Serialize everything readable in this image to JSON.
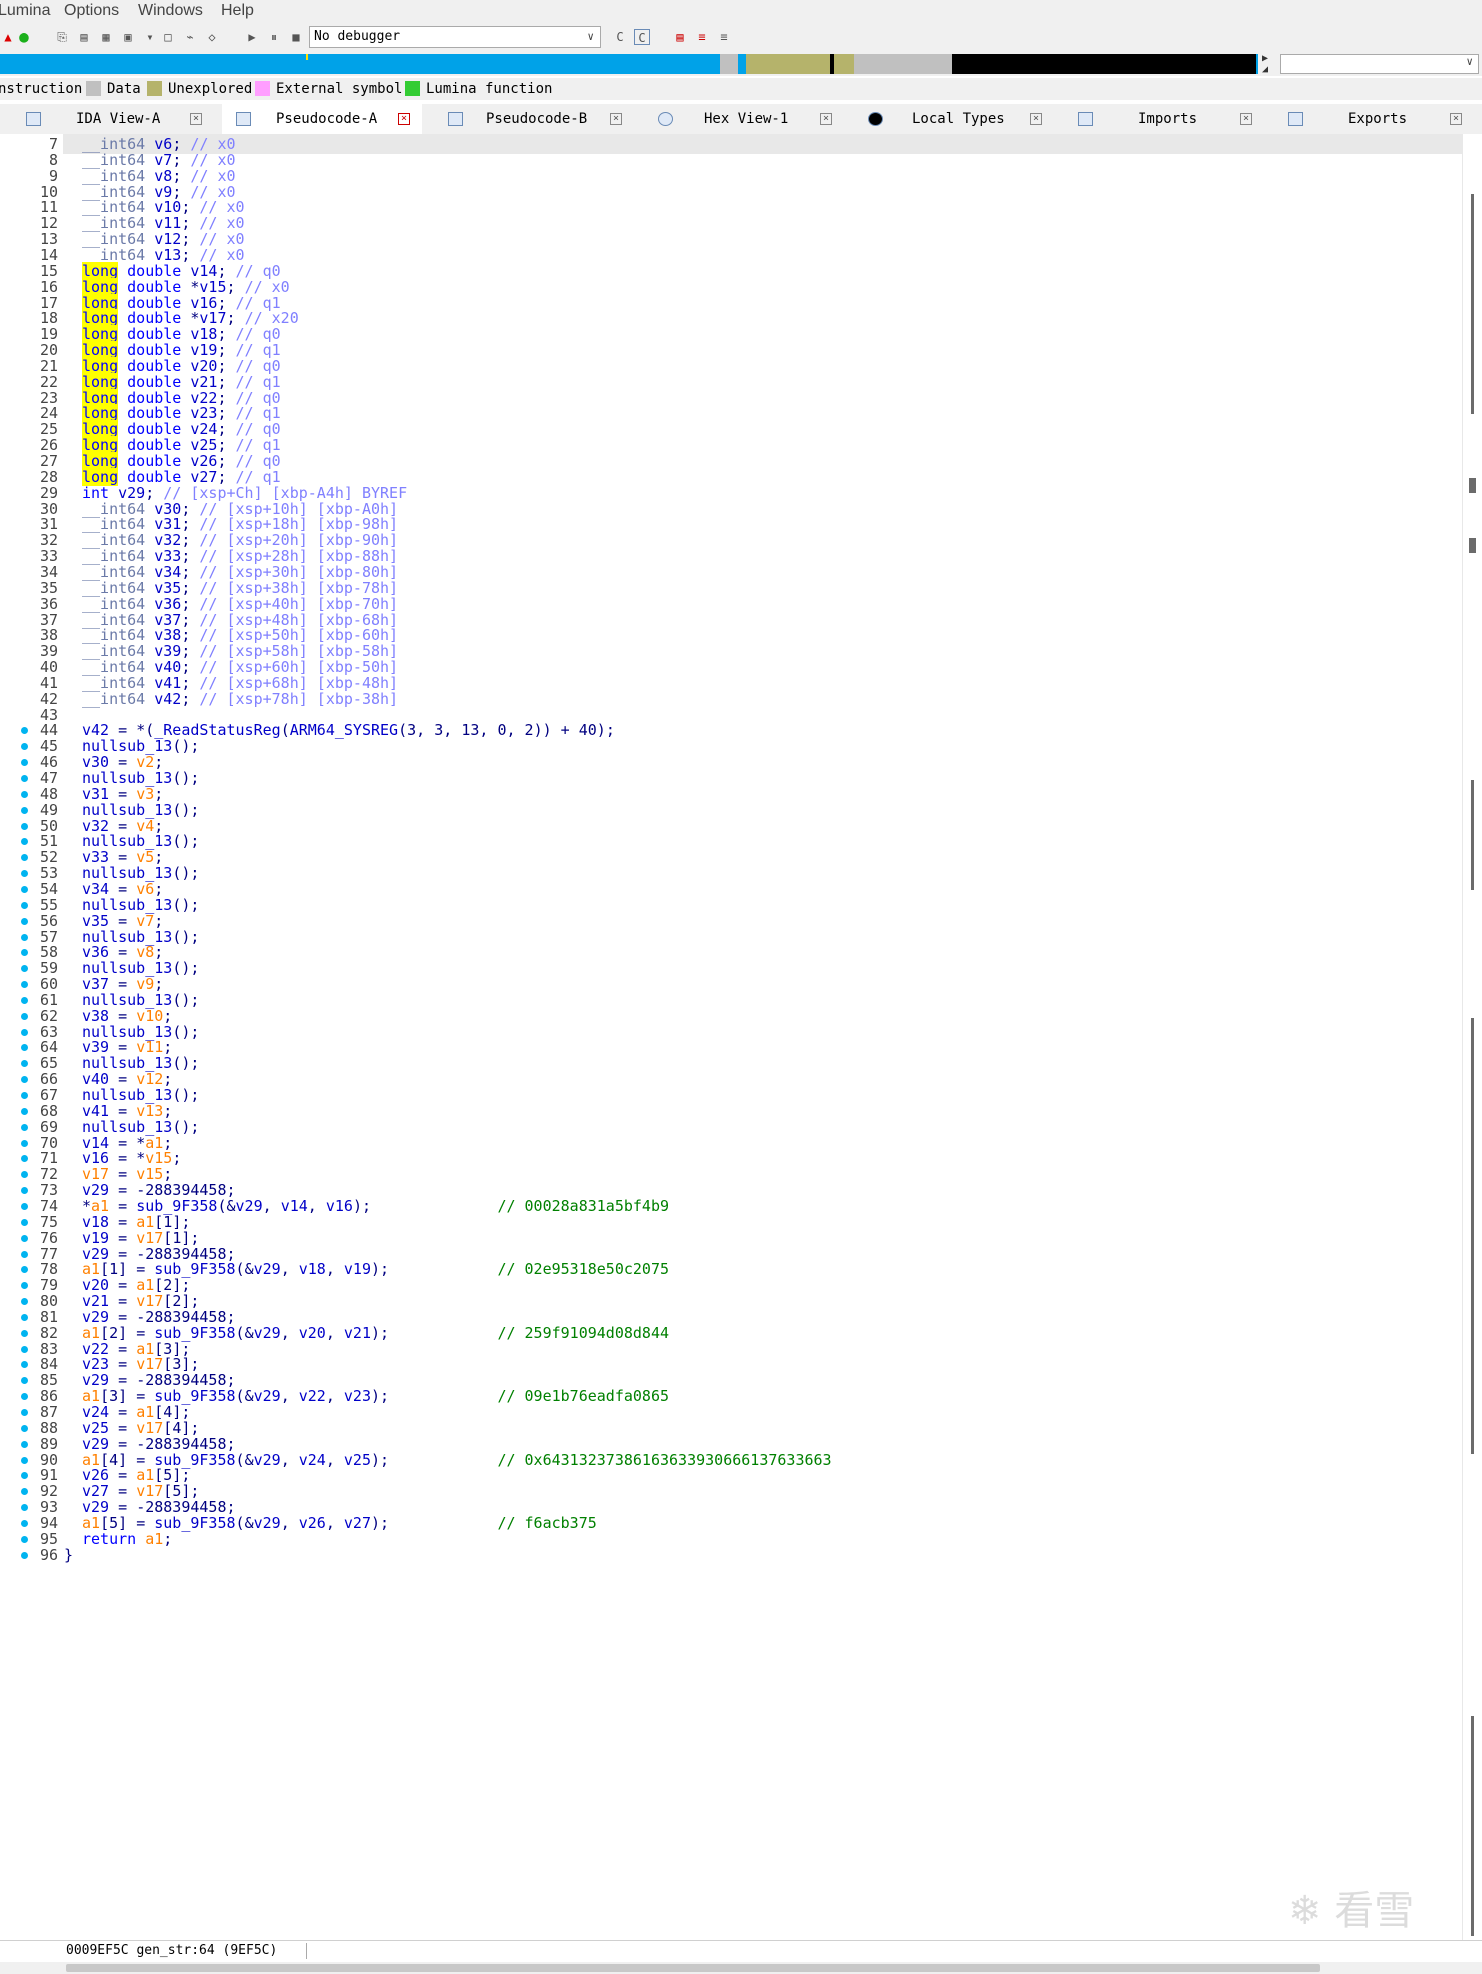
{
  "menu": {
    "items": [
      "Lumina",
      "Options",
      "Windows",
      "Help"
    ]
  },
  "toolbar": {
    "debugger": "No debugger"
  },
  "legend": {
    "items": [
      {
        "label": "nstruction",
        "color": ""
      },
      {
        "label": "Data",
        "color": "#c0c0c0"
      },
      {
        "label": "Unexplored",
        "color": "#b5b36b"
      },
      {
        "label": "External symbol",
        "color": "#ff9eff"
      },
      {
        "label": "Lumina function",
        "color": "#33cc33"
      }
    ]
  },
  "tabs": [
    {
      "label": "IDA View-A",
      "active": false
    },
    {
      "label": "Pseudocode-A",
      "active": true
    },
    {
      "label": "Pseudocode-B",
      "active": false
    },
    {
      "label": "Hex View-1",
      "active": false
    },
    {
      "label": "Local Types",
      "active": false
    },
    {
      "label": "Imports",
      "active": false
    },
    {
      "label": "Exports",
      "active": false
    }
  ],
  "code": {
    "lines": [
      {
        "n": "7",
        "dot": false,
        "t": "__int64 v6; // x0"
      },
      {
        "n": "8",
        "dot": false,
        "t": "__int64 v7; // x0"
      },
      {
        "n": "9",
        "dot": false,
        "t": "__int64 v8; // x0"
      },
      {
        "n": "10",
        "dot": false,
        "t": "__int64 v9; // x0"
      },
      {
        "n": "11",
        "dot": false,
        "t": "__int64 v10; // x0"
      },
      {
        "n": "12",
        "dot": false,
        "t": "__int64 v11; // x0"
      },
      {
        "n": "13",
        "dot": false,
        "t": "__int64 v12; // x0"
      },
      {
        "n": "14",
        "dot": false,
        "t": "__int64 v13; // x0"
      },
      {
        "n": "15",
        "dot": false,
        "t": "long double v14; // q0"
      },
      {
        "n": "16",
        "dot": false,
        "t": "long double *v15; // x0"
      },
      {
        "n": "17",
        "dot": false,
        "t": "long double v16; // q1"
      },
      {
        "n": "18",
        "dot": false,
        "t": "long double *v17; // x20"
      },
      {
        "n": "19",
        "dot": false,
        "t": "long double v18; // q0"
      },
      {
        "n": "20",
        "dot": false,
        "t": "long double v19; // q1"
      },
      {
        "n": "21",
        "dot": false,
        "t": "long double v20; // q0"
      },
      {
        "n": "22",
        "dot": false,
        "t": "long double v21; // q1"
      },
      {
        "n": "23",
        "dot": false,
        "t": "long double v22; // q0"
      },
      {
        "n": "24",
        "dot": false,
        "t": "long double v23; // q1"
      },
      {
        "n": "25",
        "dot": false,
        "t": "long double v24; // q0"
      },
      {
        "n": "26",
        "dot": false,
        "t": "long double v25; // q1"
      },
      {
        "n": "27",
        "dot": false,
        "t": "long double v26; // q0"
      },
      {
        "n": "28",
        "dot": false,
        "t": "long double v27; // q1"
      },
      {
        "n": "29",
        "dot": false,
        "t": "int v29; // [xsp+Ch] [xbp-A4h] BYREF"
      },
      {
        "n": "30",
        "dot": false,
        "t": "__int64 v30; // [xsp+10h] [xbp-A0h]"
      },
      {
        "n": "31",
        "dot": false,
        "t": "__int64 v31; // [xsp+18h] [xbp-98h]"
      },
      {
        "n": "32",
        "dot": false,
        "t": "__int64 v32; // [xsp+20h] [xbp-90h]"
      },
      {
        "n": "33",
        "dot": false,
        "t": "__int64 v33; // [xsp+28h] [xbp-88h]"
      },
      {
        "n": "34",
        "dot": false,
        "t": "__int64 v34; // [xsp+30h] [xbp-80h]"
      },
      {
        "n": "35",
        "dot": false,
        "t": "__int64 v35; // [xsp+38h] [xbp-78h]"
      },
      {
        "n": "36",
        "dot": false,
        "t": "__int64 v36; // [xsp+40h] [xbp-70h]"
      },
      {
        "n": "37",
        "dot": false,
        "t": "__int64 v37; // [xsp+48h] [xbp-68h]"
      },
      {
        "n": "38",
        "dot": false,
        "t": "__int64 v38; // [xsp+50h] [xbp-60h]"
      },
      {
        "n": "39",
        "dot": false,
        "t": "__int64 v39; // [xsp+58h] [xbp-58h]"
      },
      {
        "n": "40",
        "dot": false,
        "t": "__int64 v40; // [xsp+60h] [xbp-50h]"
      },
      {
        "n": "41",
        "dot": false,
        "t": "__int64 v41; // [xsp+68h] [xbp-48h]"
      },
      {
        "n": "42",
        "dot": false,
        "t": "__int64 v42; // [xsp+78h] [xbp-38h]"
      },
      {
        "n": "43",
        "dot": false,
        "t": ""
      },
      {
        "n": "44",
        "dot": true,
        "t": "v42 = *(_ReadStatusReg(ARM64_SYSREG(3, 3, 13, 0, 2)) + 40);"
      },
      {
        "n": "45",
        "dot": true,
        "t": "nullsub_13();"
      },
      {
        "n": "46",
        "dot": true,
        "t": "v30 = v2;"
      },
      {
        "n": "47",
        "dot": true,
        "t": "nullsub_13();"
      },
      {
        "n": "48",
        "dot": true,
        "t": "v31 = v3;"
      },
      {
        "n": "49",
        "dot": true,
        "t": "nullsub_13();"
      },
      {
        "n": "50",
        "dot": true,
        "t": "v32 = v4;"
      },
      {
        "n": "51",
        "dot": true,
        "t": "nullsub_13();"
      },
      {
        "n": "52",
        "dot": true,
        "t": "v33 = v5;"
      },
      {
        "n": "53",
        "dot": true,
        "t": "nullsub_13();"
      },
      {
        "n": "54",
        "dot": true,
        "t": "v34 = v6;"
      },
      {
        "n": "55",
        "dot": true,
        "t": "nullsub_13();"
      },
      {
        "n": "56",
        "dot": true,
        "t": "v35 = v7;"
      },
      {
        "n": "57",
        "dot": true,
        "t": "nullsub_13();"
      },
      {
        "n": "58",
        "dot": true,
        "t": "v36 = v8;"
      },
      {
        "n": "59",
        "dot": true,
        "t": "nullsub_13();"
      },
      {
        "n": "60",
        "dot": true,
        "t": "v37 = v9;"
      },
      {
        "n": "61",
        "dot": true,
        "t": "nullsub_13();"
      },
      {
        "n": "62",
        "dot": true,
        "t": "v38 = v10;"
      },
      {
        "n": "63",
        "dot": true,
        "t": "nullsub_13();"
      },
      {
        "n": "64",
        "dot": true,
        "t": "v39 = v11;"
      },
      {
        "n": "65",
        "dot": true,
        "t": "nullsub_13();"
      },
      {
        "n": "66",
        "dot": true,
        "t": "v40 = v12;"
      },
      {
        "n": "67",
        "dot": true,
        "t": "nullsub_13();"
      },
      {
        "n": "68",
        "dot": true,
        "t": "v41 = v13;"
      },
      {
        "n": "69",
        "dot": true,
        "t": "nullsub_13();"
      },
      {
        "n": "70",
        "dot": true,
        "t": "v14 = *a1;"
      },
      {
        "n": "71",
        "dot": true,
        "t": "v16 = *v15;"
      },
      {
        "n": "72",
        "dot": true,
        "t": "v17 = v15;"
      },
      {
        "n": "73",
        "dot": true,
        "t": "v29 = -288394458;"
      },
      {
        "n": "74",
        "dot": true,
        "t": "*a1 = sub_9F358(&v29, v14, v16);              // 00028a831a5bf4b9"
      },
      {
        "n": "75",
        "dot": true,
        "t": "v18 = a1[1];"
      },
      {
        "n": "76",
        "dot": true,
        "t": "v19 = v17[1];"
      },
      {
        "n": "77",
        "dot": true,
        "t": "v29 = -288394458;"
      },
      {
        "n": "78",
        "dot": true,
        "t": "a1[1] = sub_9F358(&v29, v18, v19);            // 02e95318e50c2075"
      },
      {
        "n": "79",
        "dot": true,
        "t": "v20 = a1[2];"
      },
      {
        "n": "80",
        "dot": true,
        "t": "v21 = v17[2];"
      },
      {
        "n": "81",
        "dot": true,
        "t": "v29 = -288394458;"
      },
      {
        "n": "82",
        "dot": true,
        "t": "a1[2] = sub_9F358(&v29, v20, v21);            // 259f91094d08d844"
      },
      {
        "n": "83",
        "dot": true,
        "t": "v22 = a1[3];"
      },
      {
        "n": "84",
        "dot": true,
        "t": "v23 = v17[3];"
      },
      {
        "n": "85",
        "dot": true,
        "t": "v29 = -288394458;"
      },
      {
        "n": "86",
        "dot": true,
        "t": "a1[3] = sub_9F358(&v29, v22, v23);            // 09e1b76eadfa0865"
      },
      {
        "n": "87",
        "dot": true,
        "t": "v24 = a1[4];"
      },
      {
        "n": "88",
        "dot": true,
        "t": "v25 = v17[4];"
      },
      {
        "n": "89",
        "dot": true,
        "t": "v29 = -288394458;"
      },
      {
        "n": "90",
        "dot": true,
        "t": "a1[4] = sub_9F358(&v29, v24, v25);            // 0x64313237386163633930666137633663"
      },
      {
        "n": "91",
        "dot": true,
        "t": "v26 = a1[5];"
      },
      {
        "n": "92",
        "dot": true,
        "t": "v27 = v17[5];"
      },
      {
        "n": "93",
        "dot": true,
        "t": "v29 = -288394458;"
      },
      {
        "n": "94",
        "dot": true,
        "t": "a1[5] = sub_9F358(&v29, v26, v27);            // f6acb375"
      },
      {
        "n": "95",
        "dot": true,
        "t": "return a1;"
      },
      {
        "n": "96",
        "dot": true,
        "t": "}"
      }
    ]
  },
  "status": {
    "text": "0009EF5C gen_str:64 (9EF5C)"
  },
  "watermark": {
    "text": "看雪"
  },
  "colors": {
    "navbar_blue": "#00a2e8",
    "breakpoint_dot": "#00b4f0",
    "keyword_highlight": "#ffff00"
  }
}
